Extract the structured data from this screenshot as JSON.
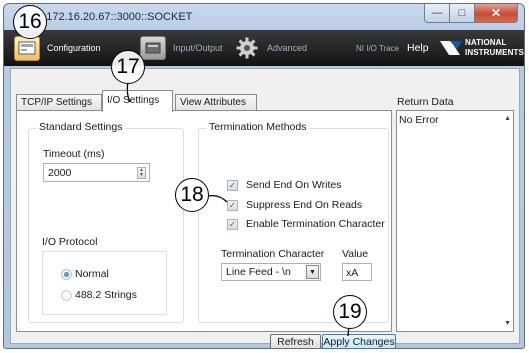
{
  "window": {
    "title": "0::172.16.20.67::3000::SOCKET",
    "minimize_glyph": "—",
    "maximize_glyph": "□",
    "close_glyph": "✕"
  },
  "toolbar": {
    "configuration_label": "Configuration",
    "input_output_label": "Input/Output",
    "advanced_label": "Advanced",
    "ni_io_trace_label": "NI I/O Trace",
    "help_label": "Help",
    "brand_line1": "NATIONAL",
    "brand_line2": "INSTRUMENTS",
    "icons": [
      "configuration-icon",
      "input-output-icon",
      "advanced-gear-icon",
      "national-instruments-logo"
    ]
  },
  "tabs": [
    "TCP/IP Settings",
    "I/O Settings",
    "View Attributes"
  ],
  "standard_settings": {
    "title": "Standard Settings",
    "timeout_label": "Timeout (ms)",
    "timeout_value": "2000",
    "io_protocol_label": "I/O Protocol",
    "protocol_options": [
      {
        "label": "Normal",
        "selected": true
      },
      {
        "label": "488.2 Strings",
        "selected": false
      }
    ]
  },
  "termination": {
    "title": "Termination Methods",
    "options": [
      {
        "label": "Send End On Writes",
        "checked": true
      },
      {
        "label": "Suppress End On Reads",
        "checked": true
      },
      {
        "label": "Enable Termination Character",
        "checked": true
      }
    ],
    "char_label": "Termination Character",
    "char_value": "Line Feed - \\n",
    "value_label": "Value",
    "value": "xA"
  },
  "buttons": {
    "refresh": "Refresh",
    "apply": "Apply Changes"
  },
  "return_data": {
    "label": "Return Data",
    "value": "No Error"
  },
  "callouts": [
    "16",
    "17",
    "18",
    "19"
  ],
  "colors": {
    "toolbar_bg": "#1a1a1a",
    "window_frame": "#b6cbe4",
    "close_button": "#c84b31",
    "ni_blue": "#0b5ca8"
  }
}
